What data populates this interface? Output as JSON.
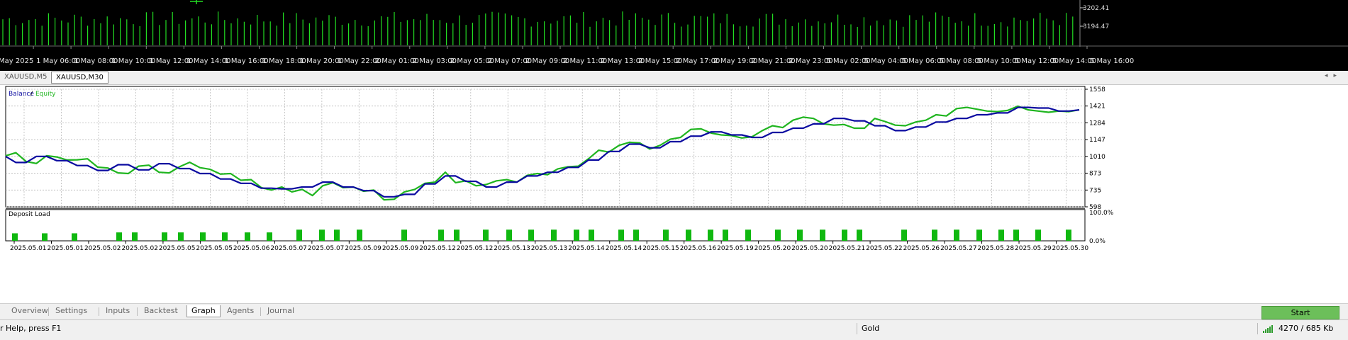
{
  "top_chart": {
    "price_labels": [
      "3202.41",
      "3194.47"
    ],
    "time_labels": [
      "May 2025",
      "1 May 06:00",
      "1 May 08:00",
      "1 May 10:00",
      "1 May 12:00",
      "1 May 14:00",
      "1 May 16:00",
      "1 May 18:00",
      "1 May 20:00",
      "1 May 22:00",
      "2 May 01:00",
      "2 May 03:00",
      "2 May 05:00",
      "2 May 07:00",
      "2 May 09:00",
      "2 May 11:00",
      "2 May 13:00",
      "2 May 15:00",
      "2 May 17:00",
      "2 May 19:00",
      "2 May 21:00",
      "2 May 23:00",
      "5 May 02:00",
      "5 May 04:00",
      "5 May 06:00",
      "5 May 08:00",
      "5 May 10:00",
      "5 May 12:00",
      "5 May 14:00",
      "5 May 16:00"
    ],
    "volume_color": "#22dd22"
  },
  "chart_tabs": [
    {
      "label": "XAUUSD,M5",
      "active": false
    },
    {
      "label": "XAUUSD,M30",
      "active": true
    }
  ],
  "chart_data": [
    {
      "type": "line",
      "title": "",
      "legend": [
        "Balance",
        "Equity"
      ],
      "legend_separator": "/",
      "colors": {
        "Balance": "#0a0aa0",
        "Equity": "#1fb51f"
      },
      "yticks": [
        "1558",
        "1421",
        "1284",
        "1147",
        "1010",
        "873",
        "735",
        "598"
      ],
      "ylim": [
        598,
        1558
      ],
      "grid": true,
      "series": [
        {
          "name": "Balance",
          "values": [
            1010,
            960,
            960,
            1010,
            1010,
            975,
            975,
            935,
            935,
            895,
            895,
            942,
            942,
            900,
            900,
            950,
            950,
            910,
            910,
            870,
            870,
            825,
            825,
            790,
            790,
            750,
            750,
            745,
            745,
            760,
            760,
            800,
            800,
            760,
            760,
            730,
            730,
            680,
            680,
            700,
            700,
            785,
            785,
            850,
            850,
            806,
            806,
            760,
            760,
            800,
            800,
            850,
            850,
            880,
            880,
            920,
            920,
            980,
            980,
            1050,
            1050,
            1110,
            1110,
            1080,
            1080,
            1130,
            1130,
            1175,
            1175,
            1210,
            1210,
            1185,
            1185,
            1165,
            1165,
            1205,
            1205,
            1240,
            1240,
            1275,
            1275,
            1320,
            1320,
            1300,
            1300,
            1260,
            1260,
            1220,
            1220,
            1250,
            1250,
            1290,
            1290,
            1320,
            1320,
            1350,
            1350,
            1365,
            1365,
            1410,
            1410,
            1405,
            1405,
            1380,
            1380,
            1390
          ]
        },
        {
          "name": "Equity",
          "values": [
            1015,
            1040,
            968,
            952,
            1015,
            1005,
            980,
            982,
            990,
            922,
            915,
            875,
            870,
            930,
            938,
            880,
            875,
            925,
            962,
            918,
            904,
            865,
            870,
            815,
            820,
            755,
            735,
            760,
            720,
            740,
            690,
            770,
            795,
            755,
            760,
            725,
            735,
            655,
            660,
            720,
            740,
            790,
            800,
            880,
            795,
            810,
            770,
            780,
            810,
            820,
            800,
            855,
            870,
            860,
            908,
            925,
            930,
            990,
            1060,
            1045,
            1100,
            1125,
            1120,
            1070,
            1100,
            1150,
            1165,
            1230,
            1235,
            1200,
            1185,
            1180,
            1160,
            1170,
            1220,
            1260,
            1245,
            1305,
            1330,
            1320,
            1275,
            1265,
            1270,
            1240,
            1240,
            1320,
            1295,
            1265,
            1260,
            1290,
            1305,
            1350,
            1340,
            1400,
            1410,
            1395,
            1380,
            1375,
            1385,
            1420,
            1390,
            1380,
            1370,
            1380,
            1375,
            1390
          ]
        }
      ]
    },
    {
      "type": "bar",
      "title": "Deposit Load",
      "yticks": [
        "100.0%",
        "0.0%"
      ],
      "ylim": [
        0,
        100
      ],
      "color": "#10b810",
      "values": [
        24,
        24,
        24,
        27,
        27,
        27,
        27,
        27,
        27,
        27,
        27,
        36,
        36,
        36,
        36,
        36,
        36,
        36,
        36,
        36,
        36,
        36,
        36,
        36,
        36,
        36,
        36,
        36,
        36,
        36,
        36,
        36,
        36,
        36,
        36,
        36,
        36,
        36,
        36,
        36,
        36,
        36,
        36,
        36,
        36,
        36,
        36,
        36,
        36,
        36,
        36,
        36,
        36,
        36,
        36,
        36,
        36,
        36,
        36,
        36,
        36,
        36
      ]
    }
  ],
  "tester_chart": {
    "legend_balance": "Balance",
    "legend_sep": " / ",
    "legend_equity": "Equity",
    "deposit_load_label": "Deposit Load",
    "date_labels": [
      "2025.05.01",
      "2025.05.01",
      "2025.05.02",
      "2025.05.02",
      "2025.05.05",
      "2025.05.05",
      "2025.05.06",
      "2025.05.07",
      "2025.05.07",
      "2025.05.09",
      "2025.05.09",
      "2025.05.12",
      "2025.05.12",
      "2025.05.13",
      "2025.05.13",
      "2025.05.14",
      "2025.05.14",
      "2025.05.15",
      "2025.05.16",
      "2025.05.19",
      "2025.05.20",
      "2025.05.20",
      "2025.05.21",
      "2025.05.22",
      "2025.05.26",
      "2025.05.27",
      "2025.05.28",
      "2025.05.29",
      "2025.05.30"
    ]
  },
  "bottom_tabs": [
    "Overview",
    "Settings",
    "Inputs",
    "Backtest",
    "Graph",
    "Agents",
    "Journal"
  ],
  "active_bottom_tab": "Graph",
  "start_label": "Start",
  "status": {
    "help": "r Help, press F1",
    "symbol": "Gold",
    "traffic": "4270 / 685 Kb"
  }
}
